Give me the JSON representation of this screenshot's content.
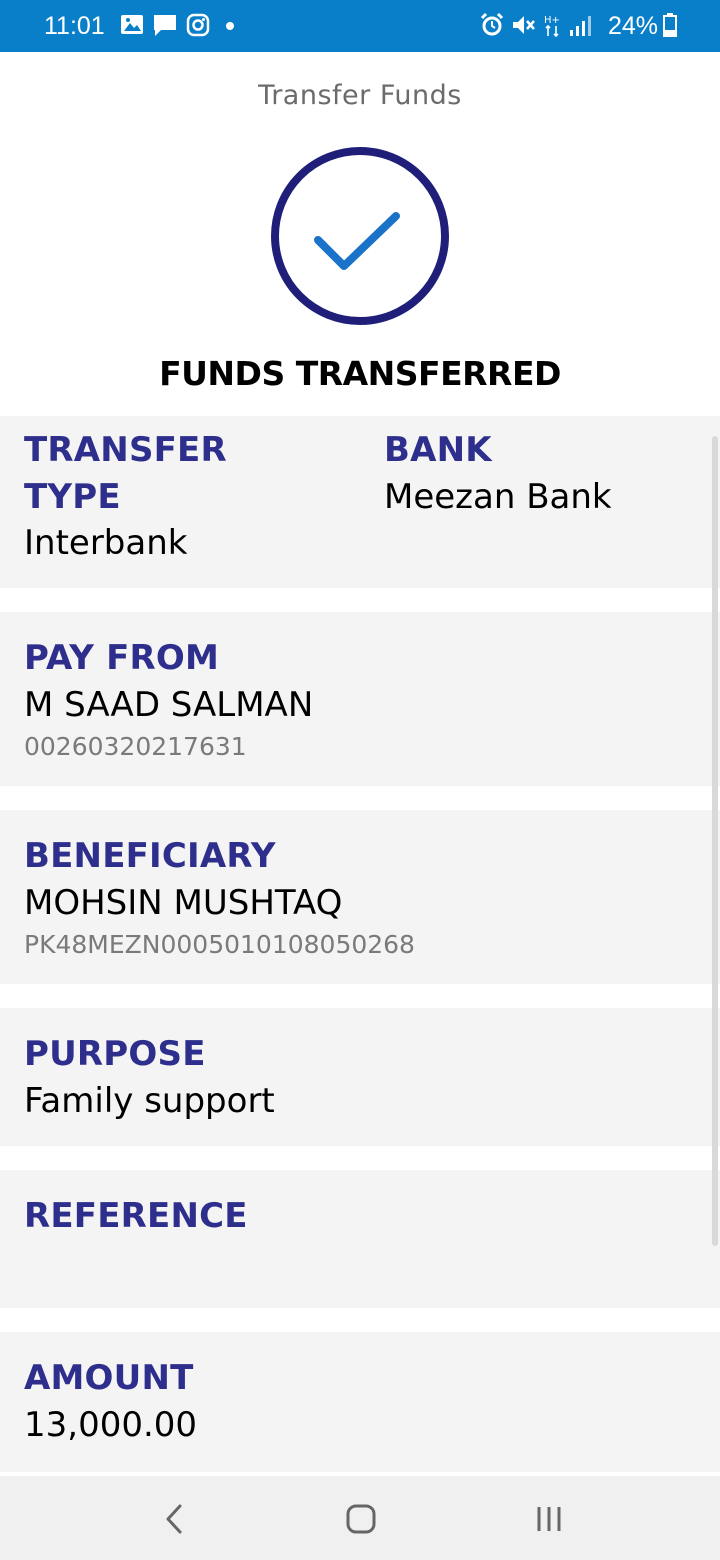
{
  "status_bar": {
    "time": "11:01",
    "battery_percent": "24%",
    "background_color": "#0a7fc9",
    "left_icons": [
      "gallery-icon",
      "message-icon",
      "instagram-icon",
      "dot-icon"
    ],
    "right_icons": [
      "alarm-icon",
      "mute-icon",
      "network-h-plus-icon",
      "signal-icon",
      "battery-icon"
    ]
  },
  "header": {
    "title": "Transfer Funds"
  },
  "result": {
    "icon": "check-circle-icon",
    "heading": "FUNDS TRANSFERRED",
    "circle_color": "#1f1f7a",
    "check_color": "#1a73c8"
  },
  "details": {
    "transfer_type": {
      "label": "TRANSFER TYPE",
      "value": "Interbank"
    },
    "bank": {
      "label": "BANK",
      "value": "Meezan Bank"
    },
    "pay_from": {
      "label": "PAY FROM",
      "name": "M SAAD SALMAN",
      "account": "00260320217631"
    },
    "beneficiary": {
      "label": "BENEFICIARY",
      "name": "MOHSIN MUSHTAQ",
      "account": "PK48MEZN0005010108050268"
    },
    "purpose": {
      "label": "PURPOSE",
      "value": "Family support"
    },
    "reference": {
      "label": "REFERENCE",
      "value": ""
    },
    "amount": {
      "label": "AMOUNT",
      "value": "13,000.00"
    }
  },
  "colors": {
    "label": "#2e2e8c",
    "card_background": "#f4f4f4",
    "sub_text": "#7a7a7a"
  },
  "nav_bar": {
    "icons": [
      "back-icon",
      "home-icon",
      "recents-icon"
    ]
  }
}
